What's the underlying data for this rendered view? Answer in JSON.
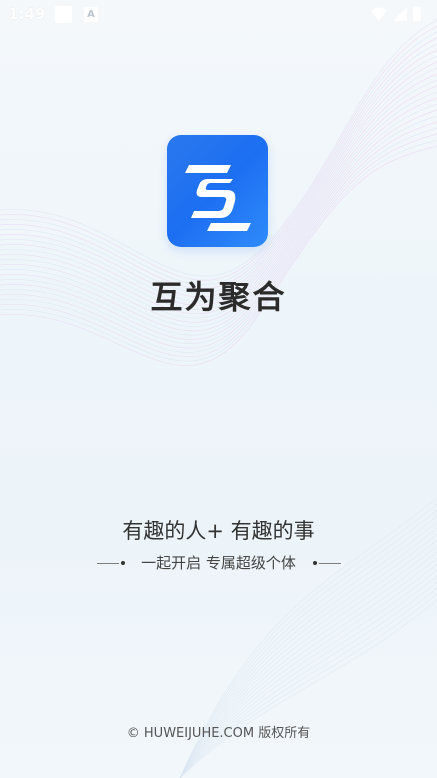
{
  "status_bar": {
    "time": "1:49",
    "notification_icons": [
      "square-notification-icon",
      "a-notification-icon"
    ],
    "system_icons": [
      "wifi-icon",
      "signal-icon",
      "battery-icon"
    ],
    "a_glyph": "A"
  },
  "app": {
    "logo_icon": "app-logo-s-icon",
    "name": "互为聚合"
  },
  "tagline": {
    "slogan": "有趣的人+ 有趣的事",
    "subtitle": "一起开启 专属超级个体"
  },
  "footer": {
    "copyright": "© HUWEIJUHE.COM 版权所有"
  },
  "colors": {
    "brand_blue": "#1d6ff2",
    "title_text": "#2b2b2b",
    "background": "#f0f6fa"
  }
}
